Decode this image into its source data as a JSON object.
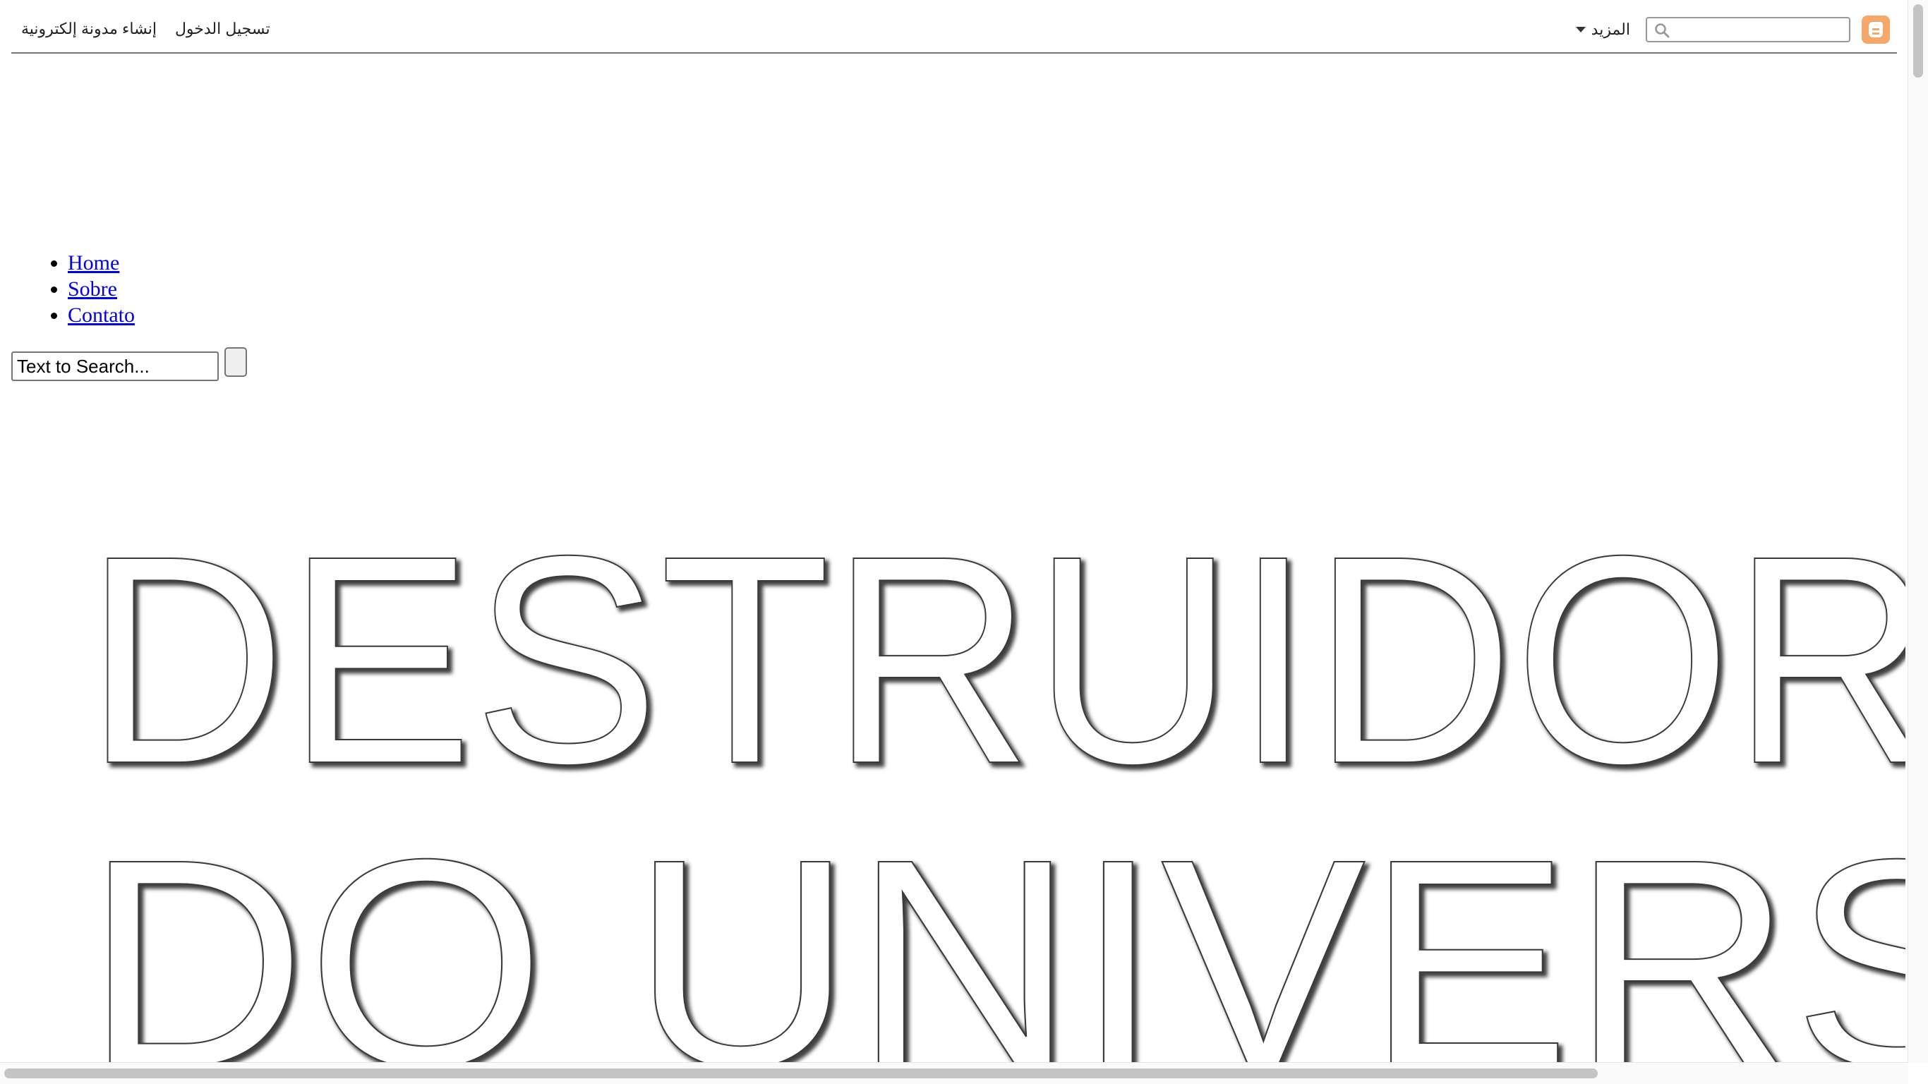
{
  "navbar": {
    "login_label": "تسجيل الدخول",
    "create_blog_label": "إنشاء مدونة إلكترونية",
    "more_label": "المزيد",
    "search_value": "",
    "brand_color": "#f6a86a",
    "icons": {
      "brand": "blogger-logo-icon",
      "search": "search-icon",
      "more": "caret-down-icon"
    }
  },
  "menu": {
    "items": [
      {
        "label": "Home"
      },
      {
        "label": "Sobre"
      },
      {
        "label": "Contato"
      }
    ]
  },
  "search_form": {
    "value": "Text to Search...",
    "submit_label": ""
  },
  "header_image": {
    "line1": "DESTRUIDOR",
    "line2": "DO UNIVERSO"
  }
}
